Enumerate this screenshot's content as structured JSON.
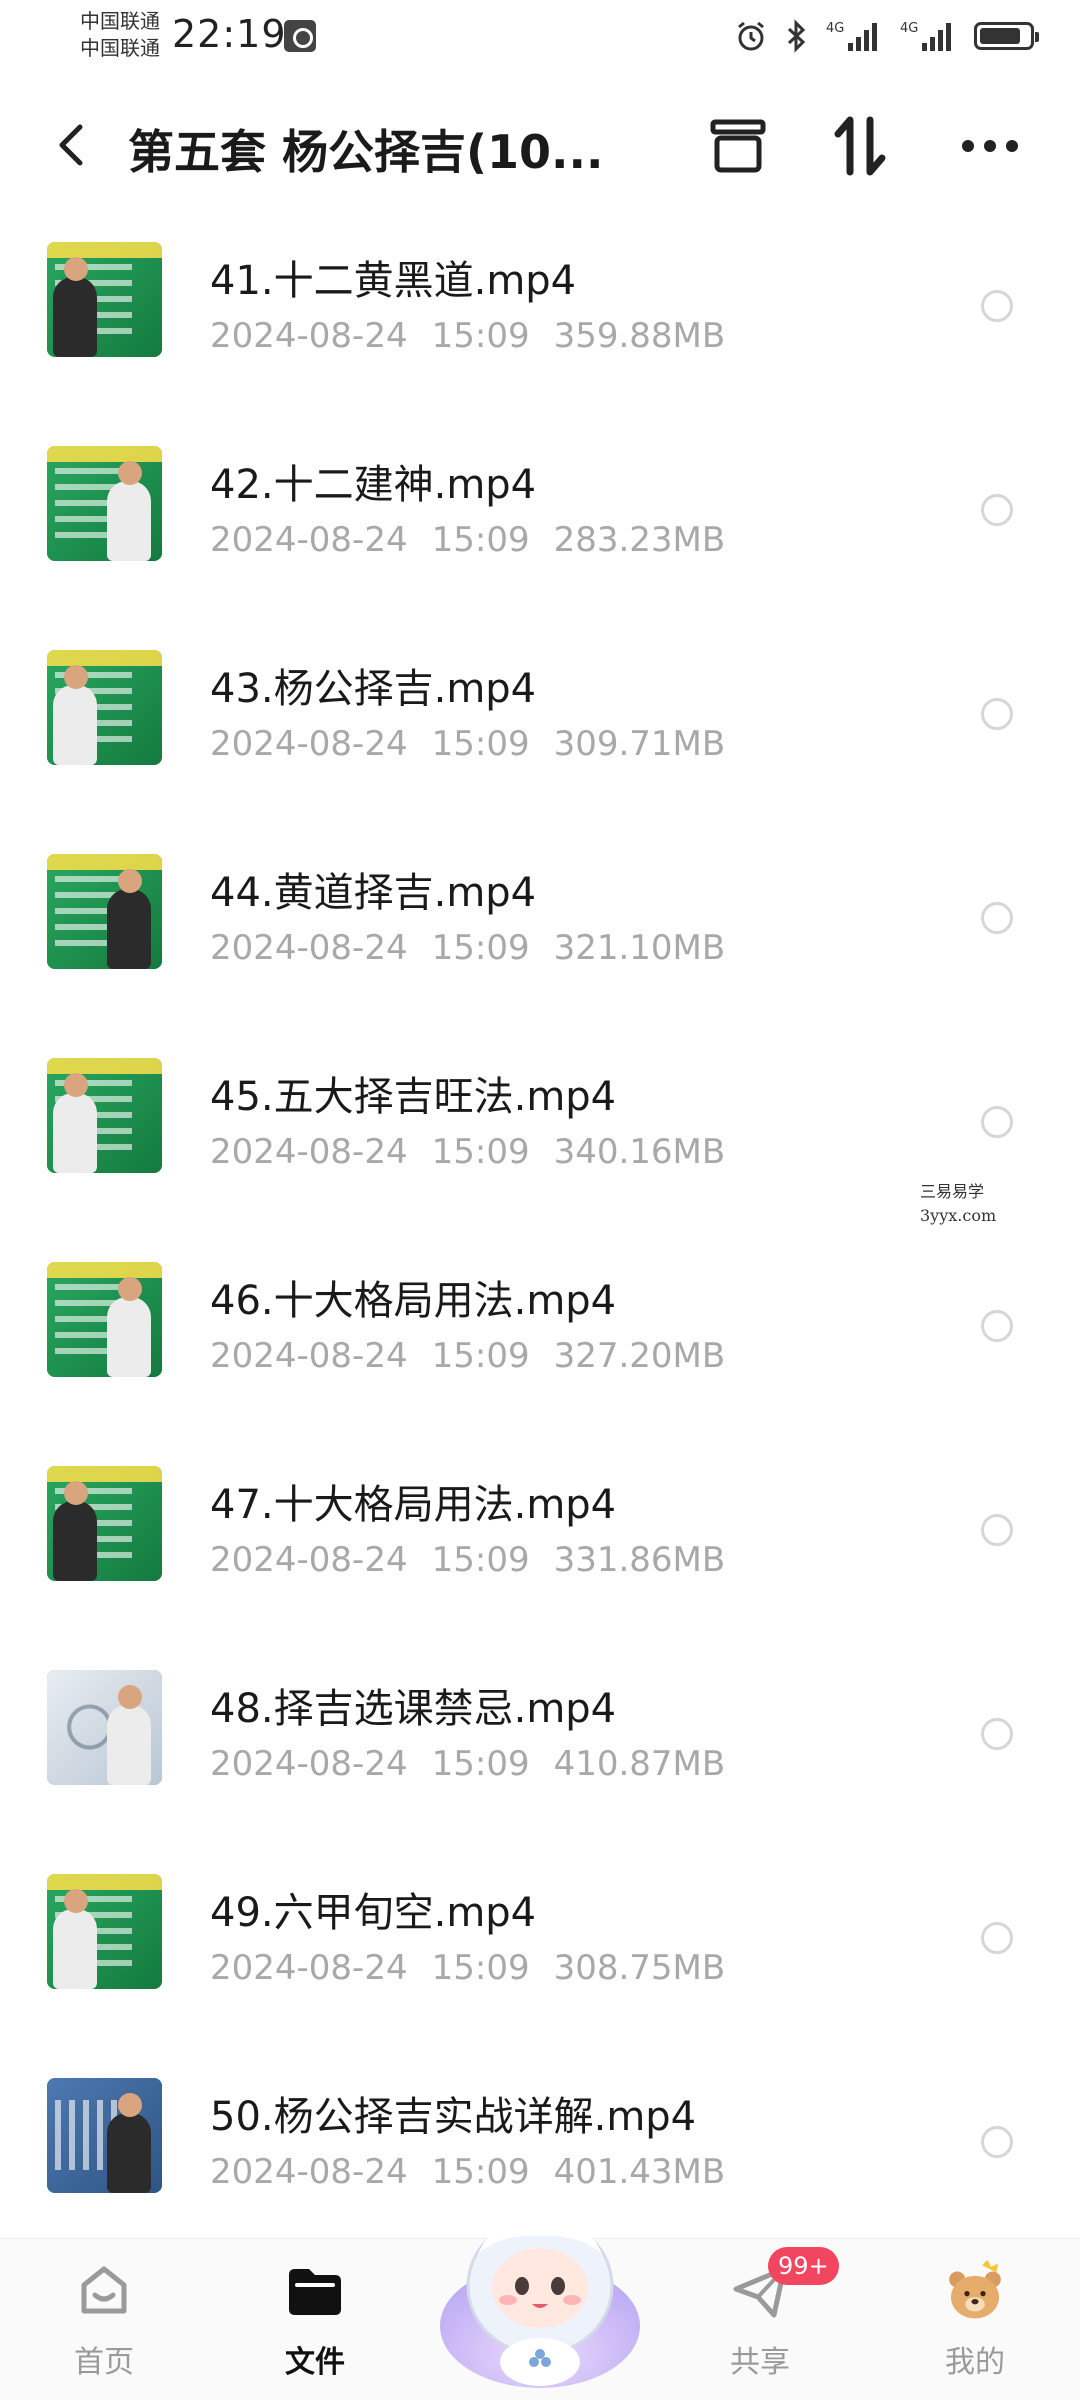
{
  "status_bar": {
    "carrier_1": "中国联通",
    "carrier_2": "中国联通",
    "time": "22:19",
    "network_1": "4G",
    "network_2": "4G",
    "icons": [
      "alarm-icon",
      "bluetooth-icon",
      "signal-icon",
      "signal-icon",
      "battery-charging-icon"
    ],
    "battery_level": 0.85
  },
  "header": {
    "title": "第五套 杨公择吉(10...",
    "back_icon": "chevron-left-icon",
    "actions": [
      "archive-box-icon",
      "sort-icon",
      "more-icon"
    ]
  },
  "files": [
    {
      "name": "41.十二黄黑道.mp4",
      "date": "2024-08-24",
      "time": "15:09",
      "size": "359.88MB",
      "thumb": "green"
    },
    {
      "name": "42.十二建神.mp4",
      "date": "2024-08-24",
      "time": "15:09",
      "size": "283.23MB",
      "thumb": "green"
    },
    {
      "name": "43.杨公择吉.mp4",
      "date": "2024-08-24",
      "time": "15:09",
      "size": "309.71MB",
      "thumb": "green"
    },
    {
      "name": "44.黄道择吉.mp4",
      "date": "2024-08-24",
      "time": "15:09",
      "size": "321.10MB",
      "thumb": "green"
    },
    {
      "name": "45.五大择吉旺法.mp4",
      "date": "2024-08-24",
      "time": "15:09",
      "size": "340.16MB",
      "thumb": "green"
    },
    {
      "name": "46.十大格局用法.mp4",
      "date": "2024-08-24",
      "time": "15:09",
      "size": "327.20MB",
      "thumb": "green"
    },
    {
      "name": "47.十大格局用法.mp4",
      "date": "2024-08-24",
      "time": "15:09",
      "size": "331.86MB",
      "thumb": "green"
    },
    {
      "name": "48.择吉选课禁忌.mp4",
      "date": "2024-08-24",
      "time": "15:09",
      "size": "410.87MB",
      "thumb": "gray"
    },
    {
      "name": "49.六甲旬空.mp4",
      "date": "2024-08-24",
      "time": "15:09",
      "size": "308.75MB",
      "thumb": "green"
    },
    {
      "name": "50.杨公择吉实战详解.mp4",
      "date": "2024-08-24",
      "time": "15:09",
      "size": "401.43MB",
      "thumb": "blue"
    }
  ],
  "watermark": {
    "line1": "三易易学",
    "line2": "3yyx.com"
  },
  "tab_bar": {
    "tabs": [
      {
        "label": "首页",
        "icon": "home-icon",
        "active": false
      },
      {
        "label": "文件",
        "icon": "folder-icon",
        "active": true
      },
      {
        "label": "",
        "icon": "mascot-icon",
        "active": false
      },
      {
        "label": "共享",
        "icon": "paper-plane-icon",
        "active": false,
        "badge": "99+"
      },
      {
        "label": "我的",
        "icon": "bear-avatar-icon",
        "active": false
      }
    ]
  },
  "colors": {
    "accent_badge": "#f2455f",
    "meta_text": "#a8a8a8",
    "thumb_board": "#1f8a4c"
  }
}
